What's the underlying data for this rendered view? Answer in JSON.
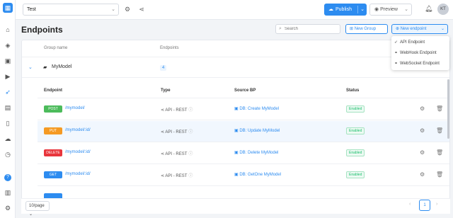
{
  "topbar": {
    "project": "Test",
    "publish_label": "Publish",
    "preview_label": "Preview",
    "avatar_initials": "KT"
  },
  "page": {
    "title": "Endpoints",
    "search_placeholder": "Search",
    "new_group_label": "New Group",
    "new_endpoint_label": "New endpoint"
  },
  "dropdown": {
    "items": [
      "API Endpoint",
      "WebHook Endpoint",
      "WebSocket Endpoint"
    ]
  },
  "group_table": {
    "headers": [
      "Group name",
      "Endpoints"
    ],
    "rows": [
      {
        "name": "MyModel",
        "count": "4"
      }
    ]
  },
  "endpoint_table": {
    "headers": [
      "Endpoint",
      "Type",
      "Source BP",
      "Status"
    ],
    "rows": [
      {
        "method": "POST",
        "method_color": "#4cbb5b",
        "path": "/mymodel/",
        "type": "API - REST",
        "source": "DB: Create MyModel",
        "status": "Enabled"
      },
      {
        "method": "PUT",
        "method_color": "#f59a23",
        "path": "/mymodel/:id/",
        "type": "API - REST",
        "source": "DB: Update MyModel",
        "status": "Enabled"
      },
      {
        "method": "DELETE",
        "method_color": "#e8353c",
        "path": "/mymodel/:id/",
        "type": "API - REST",
        "source": "DB: Delete MyModel",
        "status": "Enabled"
      },
      {
        "method": "GET",
        "method_color": "#2d8cf0",
        "path": "/mymodel/:id/",
        "type": "API - REST",
        "source": "DB: GetOne MyModel",
        "status": "Enabled"
      }
    ]
  },
  "footer": {
    "page_size": "10/page",
    "current_page": "1"
  }
}
